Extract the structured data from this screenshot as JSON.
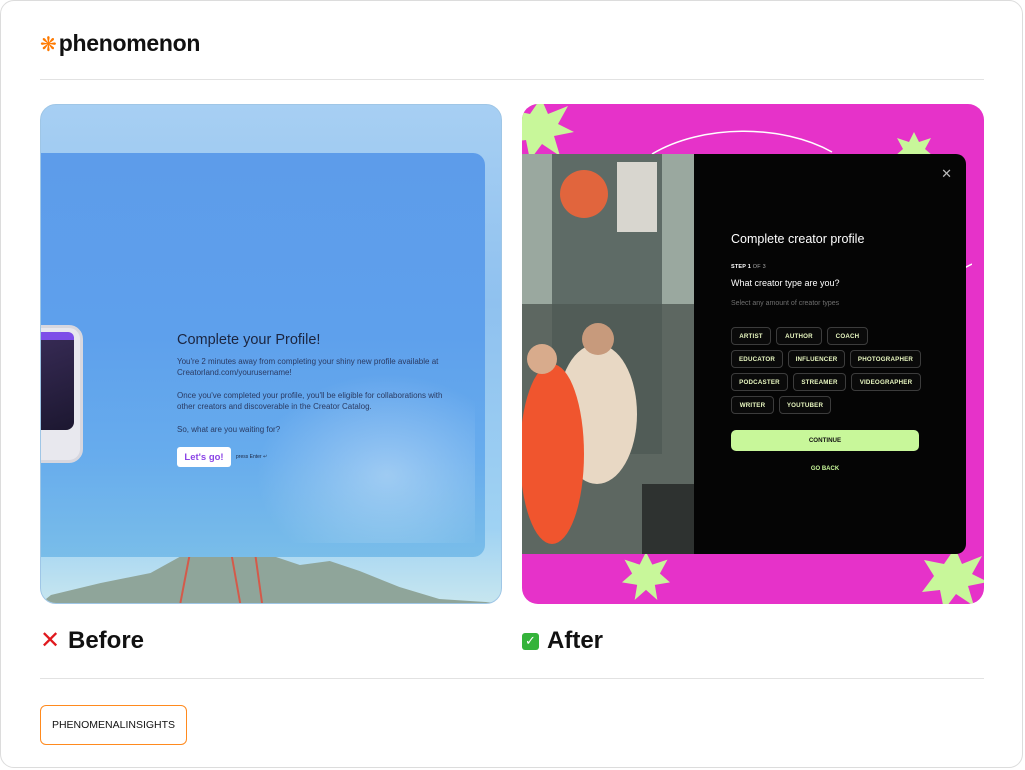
{
  "brand": {
    "name": "phenomenon",
    "mark": "❋",
    "accent": "#ff7a00"
  },
  "before_panel": {
    "label": "Before",
    "title": "Complete your Profile!",
    "paragraph_1": "You're 2 minutes away from completing your shiny new profile available at Creatorland.com/yourusername!",
    "paragraph_2": "Once you've completed your profile, you'll be eligible for collaborations with other creators and discoverable in the Creator Catalog.",
    "paragraph_3": "So, what are you waiting for?",
    "button": "Let's go!",
    "hint": "press Enter ↵"
  },
  "after_panel": {
    "label": "After",
    "title": "Complete creator profile",
    "step_current": "STEP 1",
    "step_total": "OF 3",
    "question": "What creator type are you?",
    "hint": "Select any amount of creator types",
    "chips": [
      "ARTIST",
      "AUTHOR",
      "COACH",
      "EDUCATOR",
      "INFLUENCER",
      "PHOTOGRAPHER",
      "PODCASTER",
      "STREAMER",
      "VIDEOGRAPHER",
      "WRITER",
      "YOUTUBER"
    ],
    "continue": "CONTINUE",
    "back": "GO BACK",
    "colors": {
      "background": "#e632c9",
      "accent": "#c8f79a",
      "dialog": "#050505"
    }
  },
  "footer": {
    "tag": "PHENOMENALINSIGHTS"
  }
}
